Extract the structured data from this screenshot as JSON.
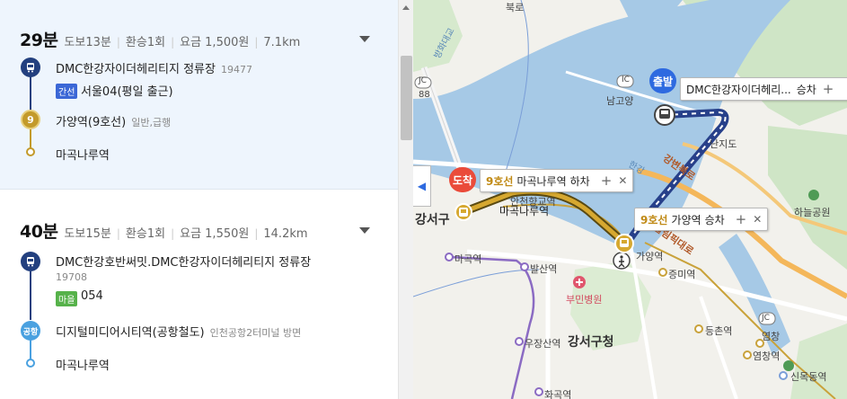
{
  "routes": [
    {
      "time": "29분",
      "walk": "도보13분",
      "transfer": "환승1회",
      "fare": "요금 1,500원",
      "distance": "7.1km",
      "steps": [
        {
          "icon": "bus",
          "name": "DMC한강자이더헤리티지 정류장",
          "sub": "19477",
          "badge": "간선",
          "badge_color": "#3b67d6",
          "bus": "서울04(평일 출근)"
        },
        {
          "icon": "9",
          "name": "가양역(9호선)",
          "sub": "일반,급행"
        },
        {
          "icon": "dot",
          "name": "마곡나루역"
        }
      ]
    },
    {
      "time": "40분",
      "walk": "도보15분",
      "transfer": "환승1회",
      "fare": "요금 1,550원",
      "distance": "14.2km",
      "steps": [
        {
          "icon": "bus",
          "name": "DMC한강호반써밋.DMC한강자이더헤리티지 정류장",
          "sub": "19708",
          "badge": "마을",
          "badge_color": "#56b24a",
          "bus": "054"
        },
        {
          "icon": "공항",
          "name": "디지털미디어시티역(공항철도)",
          "sub": "인천공항2터미널 방면"
        },
        {
          "icon": "dot",
          "name": "마곡나루역"
        }
      ]
    }
  ],
  "map": {
    "start_pin": "출발",
    "end_pin": "도착",
    "start_callout": {
      "name": "DMC한강자이더헤리...",
      "action": "승차",
      "plus": "+"
    },
    "transfer_callout": {
      "line": "9호선",
      "name": "가양역",
      "action": "승차",
      "plus": "+",
      "close": "✕"
    },
    "end_callout": {
      "line": "9호선",
      "name": "마곡나루역",
      "action": "하차",
      "plus": "+",
      "close": "✕"
    },
    "labels": {
      "bukno": "북로",
      "banghwa": "방화대교",
      "jc_left": "JC",
      "num88": "88",
      "ic": "IC",
      "nogoyang": "남고양",
      "nanjido": "난지도",
      "hangang": "한강",
      "gangbyeonbukro": "강변북로",
      "olympic": "올림픽대로",
      "haneul_park": "하늘공원",
      "gangseogu": "강서구",
      "magok_naru": "마곡나루역",
      "anchun": "안천향교역",
      "magok": "마곡역",
      "balsan": "발산역",
      "jeungmi": "증미역",
      "gayang": "가양역",
      "bumin": "부민병원",
      "deungchon": "등촌역",
      "yeomchang": "염창역",
      "jc_right": "JC",
      "yeomchang2": "염창",
      "ujangsan": "우장산역",
      "gangseo_office": "강서구청",
      "sinmokdong": "신목동역",
      "hwagok": "화곡역",
      "daeto": "대덕",
      "seongsan": "성산"
    }
  },
  "colors": {
    "accent": "#2e6ae0",
    "line9": "#bd8f1b",
    "bus_blue": "#22407f",
    "airport": "#4aa1e0",
    "route_selected_bg": "#eef5fd"
  }
}
